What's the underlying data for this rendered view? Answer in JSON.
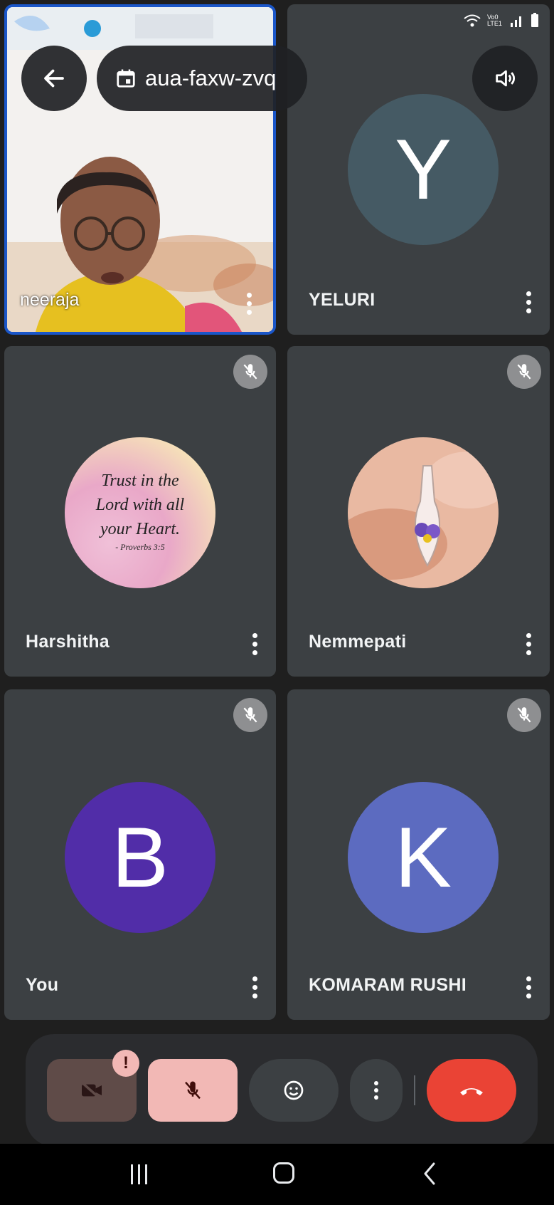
{
  "status_bar": {
    "network": "Vo0 LTE1"
  },
  "header": {
    "meeting_code": "aua-faxw-zvq"
  },
  "participants": [
    {
      "name": "neeraja",
      "type": "video"
    },
    {
      "name": "YELURI",
      "initial": "Y",
      "color": "#455a64"
    },
    {
      "name": "Harshitha",
      "type": "image",
      "image_text": [
        "Trust in the",
        "Lord with all",
        "your Heart."
      ],
      "image_caption": "- Proverbs 3:5"
    },
    {
      "name": "Nemmepati",
      "type": "image"
    },
    {
      "name": "You",
      "initial": "B",
      "color": "#512da8"
    },
    {
      "name": "KOMARAM RUSHI",
      "initial": "K",
      "color": "#5c6bc0"
    }
  ],
  "controls": {
    "camera_alert": "!",
    "colors": {
      "camera": "#5f4b48",
      "mic": "#f2b8b5",
      "end_call": "#ea4335",
      "neutral": "#3c4043"
    }
  }
}
